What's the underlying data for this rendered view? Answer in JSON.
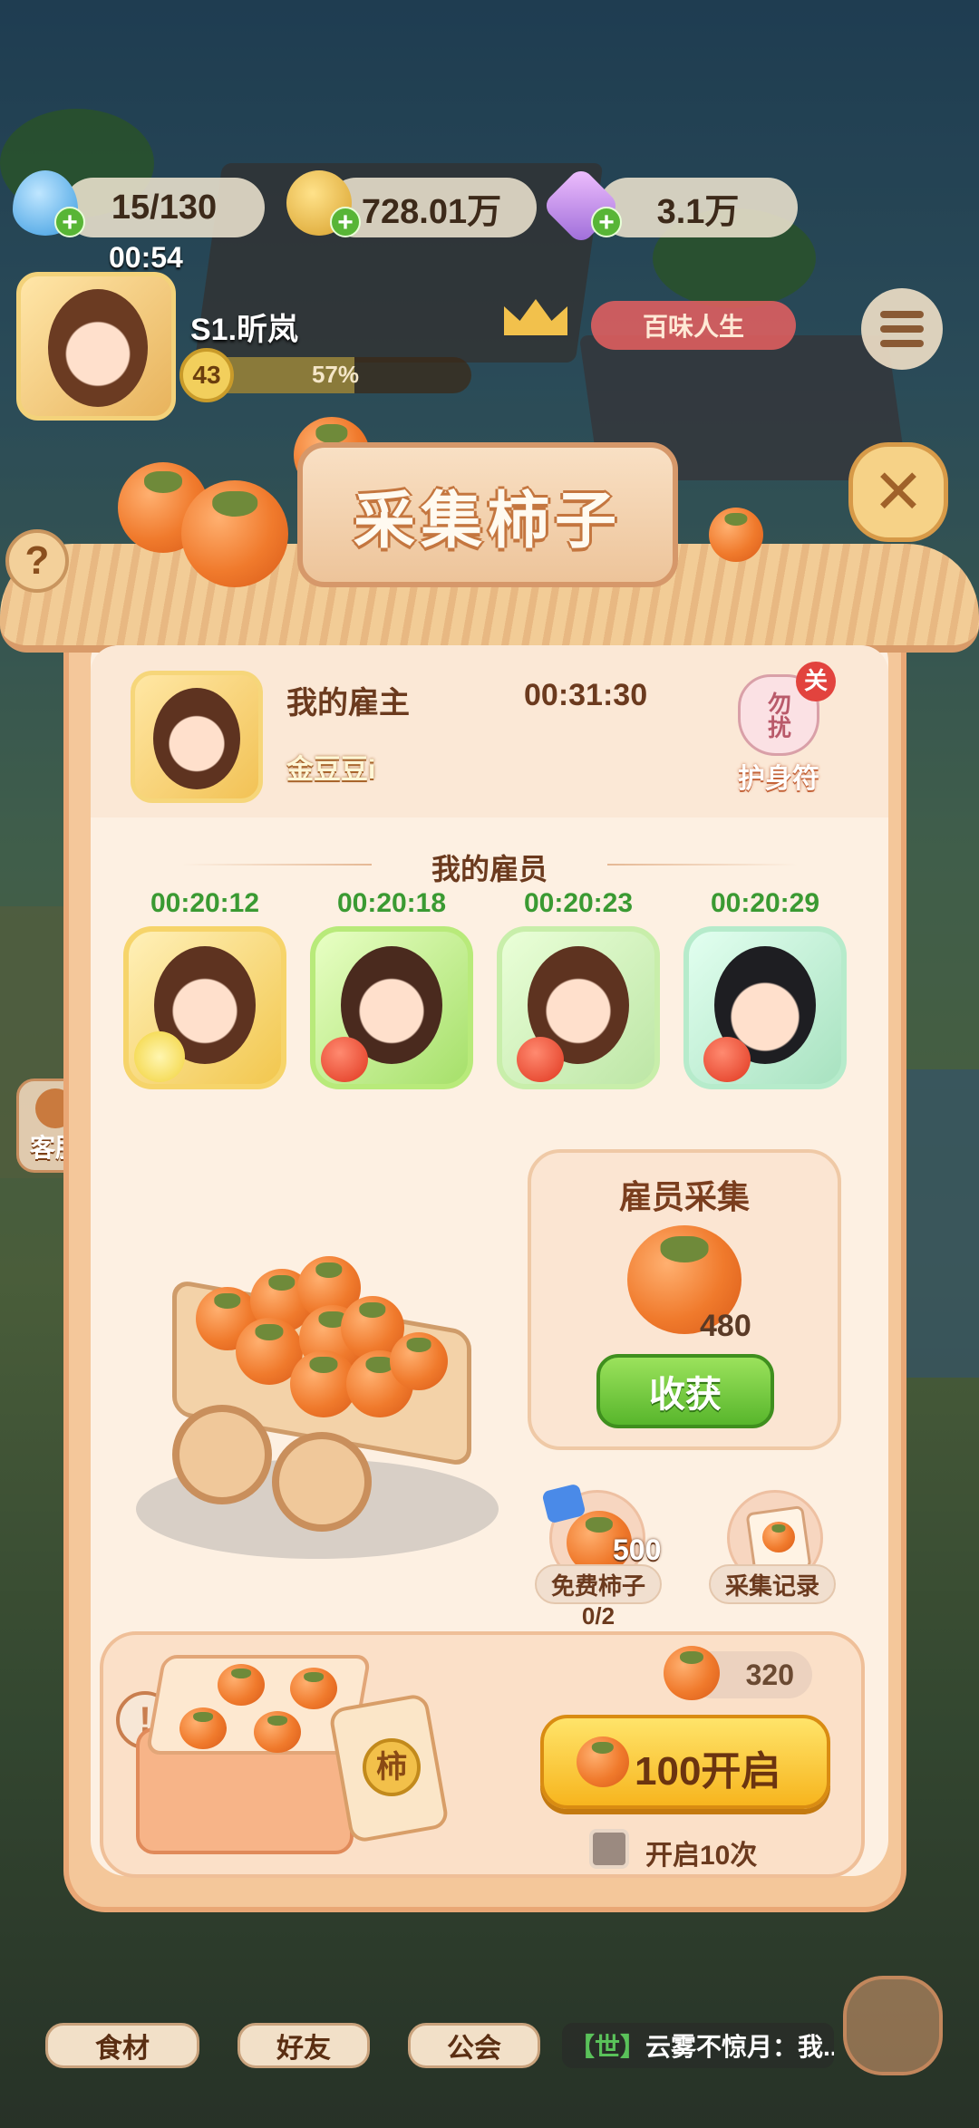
{
  "resources": {
    "water": "15/130",
    "coins": "728.01万",
    "gems": "3.1万",
    "water_timer": "00:54"
  },
  "player": {
    "name": "S1.昕岚",
    "level": "43",
    "progress_label": "57%",
    "progress": 0.57,
    "title_badge": "百味人生"
  },
  "panel": {
    "title": "采集柿子",
    "employer_label": "我的雇主",
    "employer_timer": "00:31:30",
    "employer_name": "金豆豆i",
    "amulet_label": "护身符",
    "amulet_tag": "勿扰",
    "amulet_badge": "关",
    "employees_title": "我的雇员",
    "employees": [
      {
        "timer": "00:20:12"
      },
      {
        "timer": "00:20:18"
      },
      {
        "timer": "00:20:23"
      },
      {
        "timer": "00:20:29"
      }
    ],
    "gather_card_title": "雇员采集",
    "gather_count": "480",
    "harvest_button": "收获",
    "free_persimmon_label": "免费柿子",
    "free_persimmon_count": "500",
    "free_persimmon_uses": "0/2",
    "records_label": "采集记录",
    "balance": "320",
    "open_button": "100开启",
    "open_ten_label": "开启10次",
    "box_seal": "柿"
  },
  "side": {
    "customer_service": "客服"
  },
  "bottom_nav": {
    "ingredients": "食材",
    "friends": "好友",
    "guild": "公会",
    "chat_channel": "【世】",
    "chat_message": "云雾不惊月：我..."
  },
  "colors": {
    "panel_bg": "#fdf0e2",
    "timer_green": "#3a9a32",
    "harvest_green": "#58b62c",
    "open_yellow": "#f7b51e",
    "persimmon": "#f07a2c"
  }
}
